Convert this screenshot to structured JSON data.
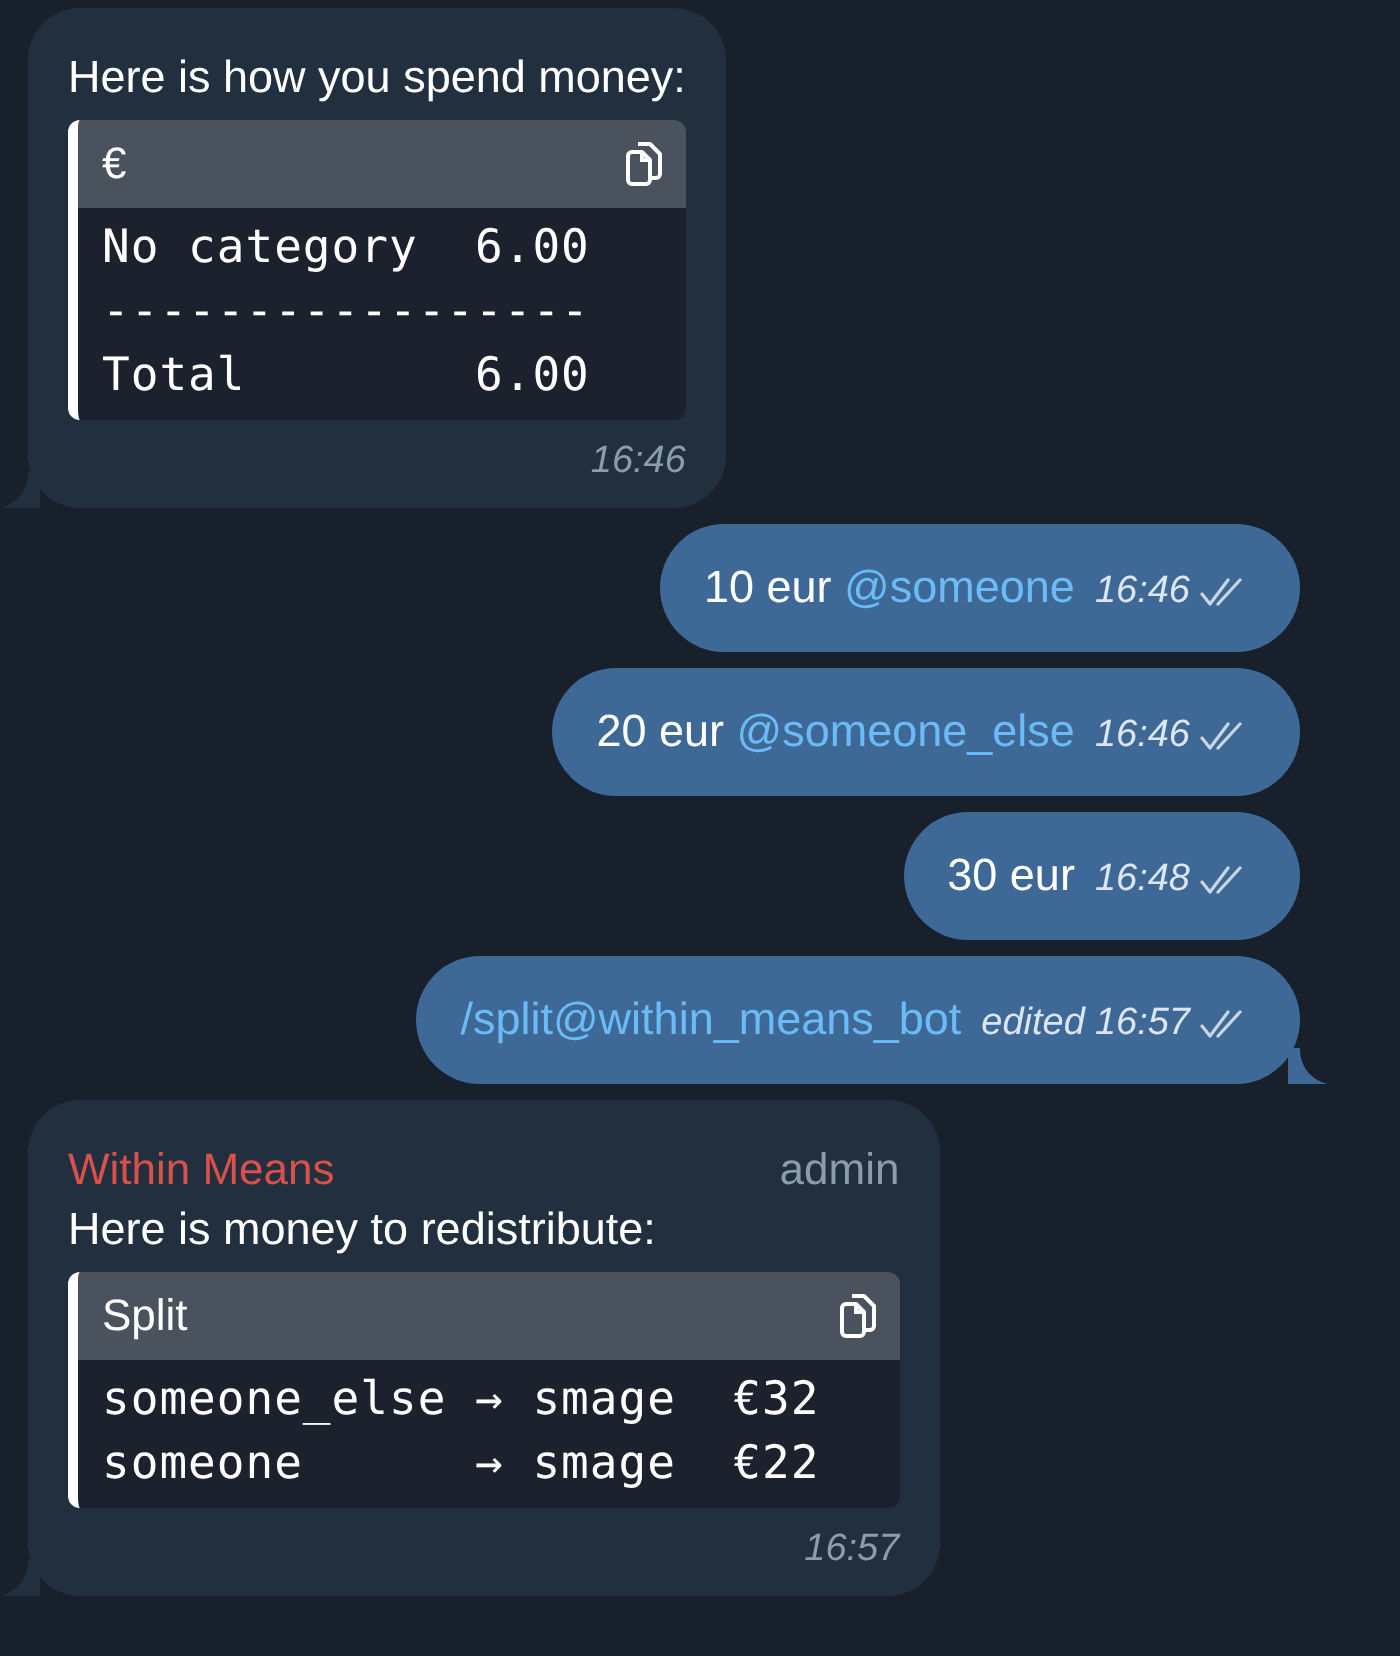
{
  "messages": [
    {
      "kind": "incoming",
      "text": "Here is how you spend money:",
      "code": {
        "header": "€",
        "lines": [
          "No category  6.00",
          "-----------------",
          "Total        6.00"
        ]
      },
      "time": "16:46",
      "tail": true
    },
    {
      "kind": "outgoing",
      "parts": [
        {
          "kind": "plain",
          "text": "10 eur "
        },
        {
          "kind": "mention",
          "text": "@someone"
        }
      ],
      "time": "16:46",
      "read": true,
      "tail": false
    },
    {
      "kind": "outgoing",
      "parts": [
        {
          "kind": "plain",
          "text": "20 eur "
        },
        {
          "kind": "mention",
          "text": "@someone_else"
        }
      ],
      "time": "16:46",
      "read": true,
      "tail": false
    },
    {
      "kind": "outgoing",
      "parts": [
        {
          "kind": "plain",
          "text": "30 eur"
        }
      ],
      "time": "16:48",
      "read": true,
      "tail": false
    },
    {
      "kind": "outgoing",
      "parts": [
        {
          "kind": "mention",
          "text": "/split@within_means_bot"
        }
      ],
      "edited": "edited",
      "time": "16:57",
      "read": true,
      "tail": true
    },
    {
      "kind": "incoming",
      "sender": "Within Means",
      "role": "admin",
      "text": "Here is money to redistribute:",
      "code": {
        "header": "Split",
        "lines": [
          "someone_else → smage  €32",
          "someone      → smage  €22"
        ]
      },
      "time": "16:57",
      "tail": true
    }
  ]
}
